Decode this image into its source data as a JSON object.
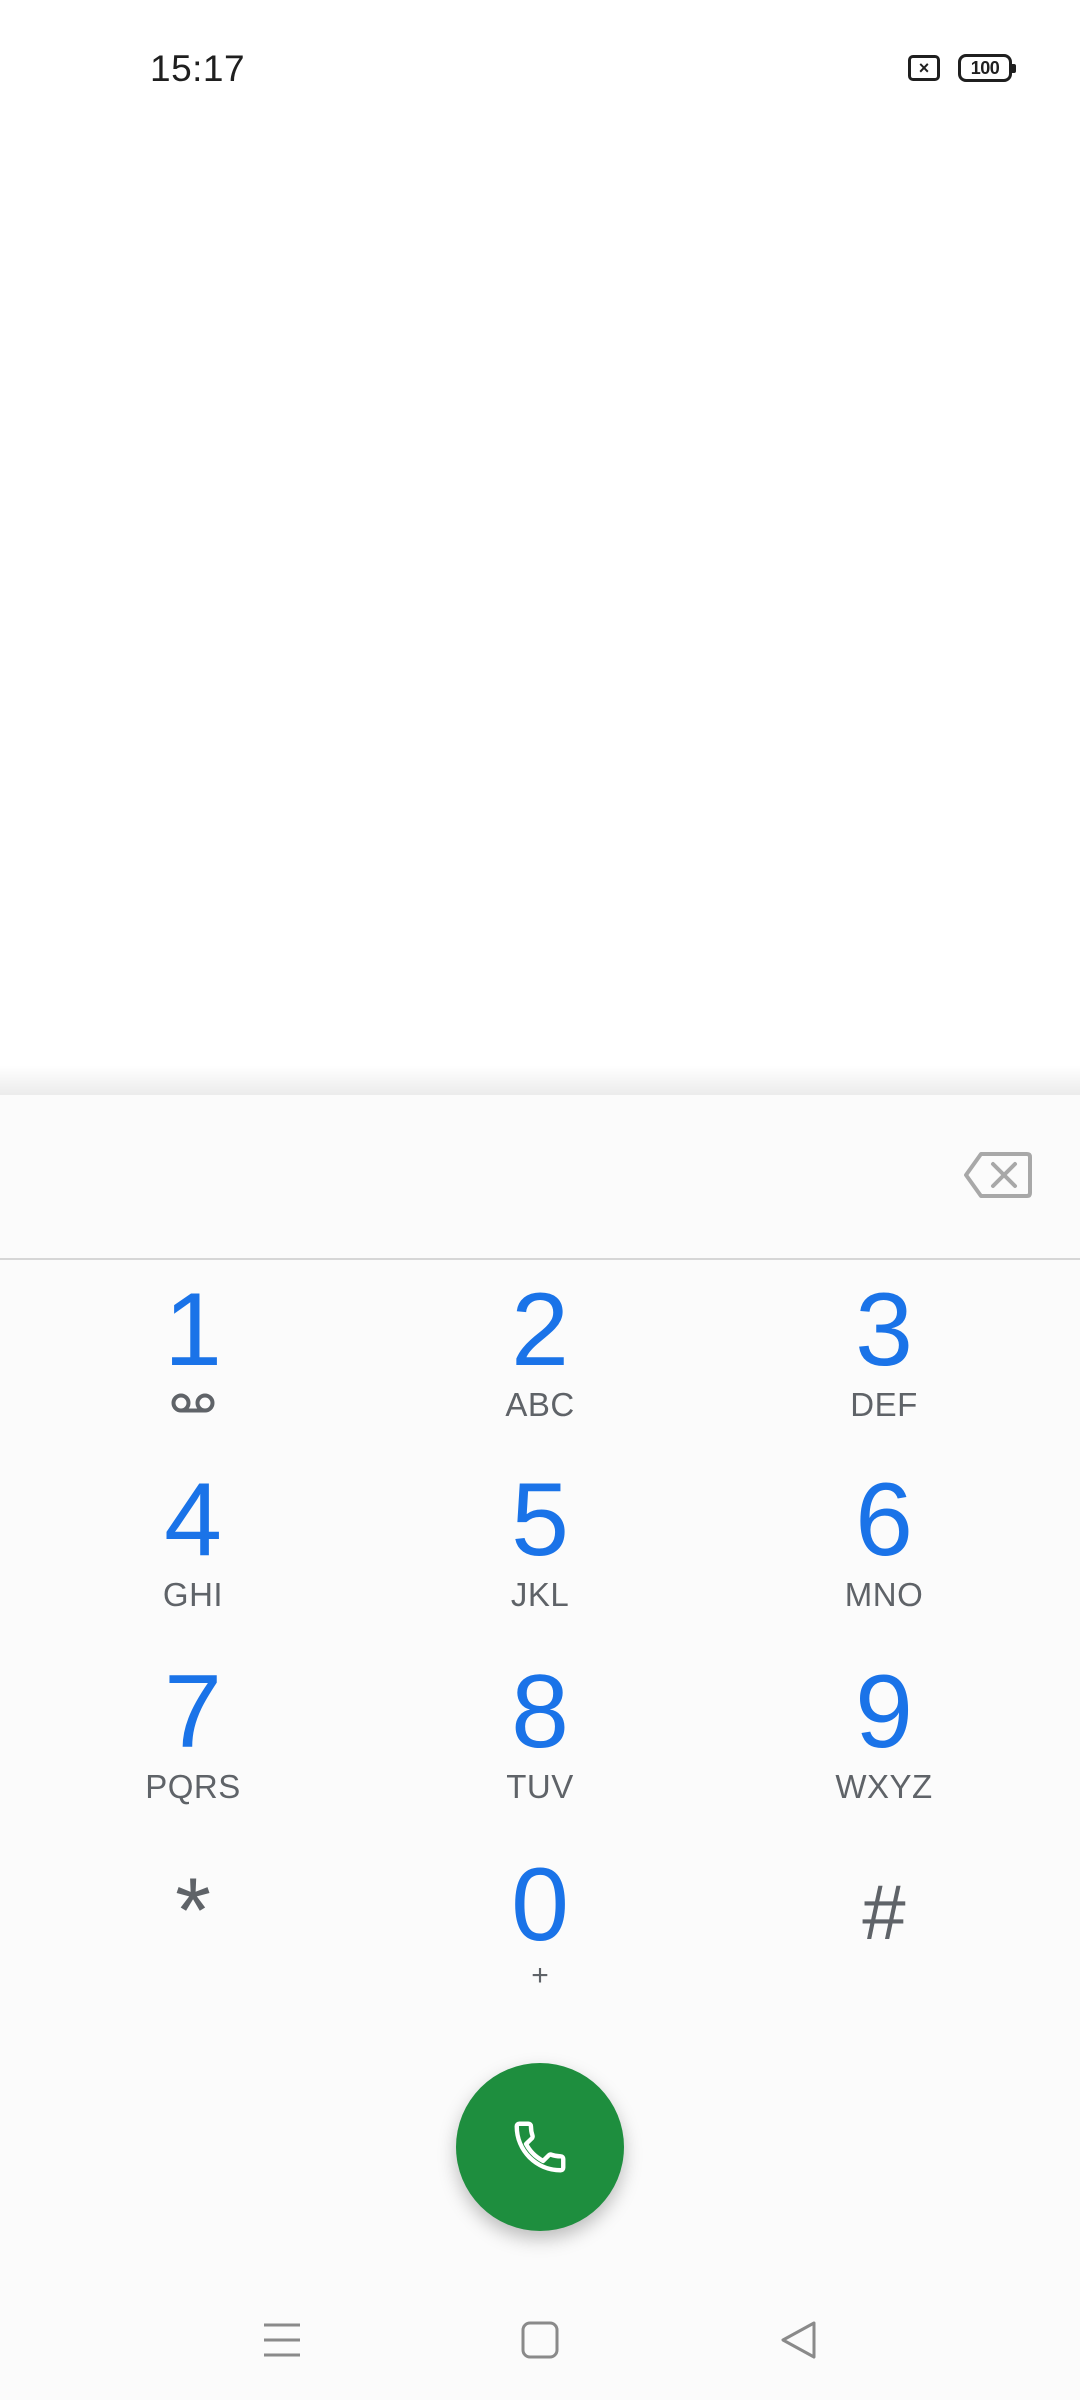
{
  "status_bar": {
    "time": "15:17",
    "sim_icon": "no-sim-icon",
    "sim_glyph": "×",
    "battery_level": "100"
  },
  "dialer": {
    "digits_value": "",
    "backspace_icon": "backspace-icon",
    "keys": [
      {
        "digit": "1",
        "letters": "",
        "icon": "voicemail-icon"
      },
      {
        "digit": "2",
        "letters": "ABC"
      },
      {
        "digit": "3",
        "letters": "DEF"
      },
      {
        "digit": "4",
        "letters": "GHI"
      },
      {
        "digit": "5",
        "letters": "JKL"
      },
      {
        "digit": "6",
        "letters": "MNO"
      },
      {
        "digit": "7",
        "letters": "PQRS"
      },
      {
        "digit": "8",
        "letters": "TUV"
      },
      {
        "digit": "9",
        "letters": "WXYZ"
      },
      {
        "digit": "*",
        "letters": ""
      },
      {
        "digit": "0",
        "letters": "+"
      },
      {
        "digit": "#",
        "letters": ""
      }
    ],
    "call_icon": "phone-icon"
  },
  "nav_bar": {
    "menu_icon": "menu-icon",
    "home_icon": "home-icon",
    "back_icon": "back-icon"
  },
  "colors": {
    "digit_blue": "#1a73e8",
    "call_green": "#1e8e3e",
    "letters_gray": "#5f6368"
  }
}
